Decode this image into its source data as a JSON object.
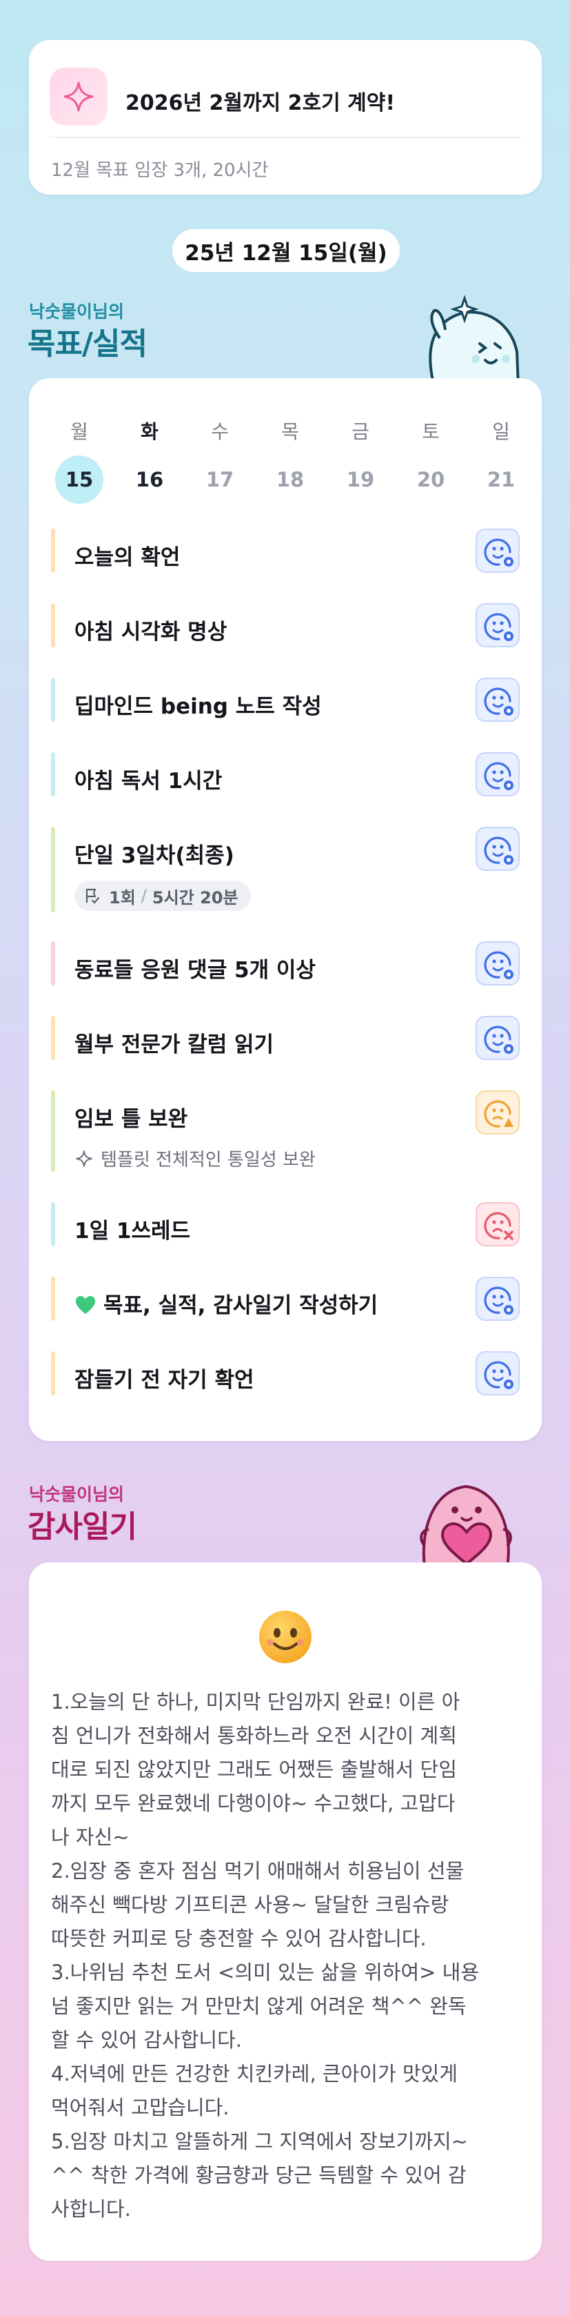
{
  "contract": {
    "title": "2026년 2월까지 2호기 계약!",
    "subtitle": "12월 목표  임장 3개, 20시간"
  },
  "date_label": "25년 12월 15일(월)",
  "goals_section": {
    "owner": "낙숫물이님의",
    "title": "목표/실적"
  },
  "week": {
    "days": [
      "월",
      "화",
      "수",
      "목",
      "금",
      "토",
      "일"
    ],
    "dates": [
      "15",
      "16",
      "17",
      "18",
      "19",
      "20",
      "21"
    ]
  },
  "goals": [
    {
      "title": "오늘의 확언",
      "bar_color": "#fde0b4",
      "status": "done"
    },
    {
      "title": "아침 시각화 명상",
      "bar_color": "#fde0b4",
      "status": "done"
    },
    {
      "title": "딥마인드 being 노트 작성",
      "bar_color": "#c8ecf4",
      "status": "done"
    },
    {
      "title": "아침 독서 1시간",
      "bar_color": "#c8ecf4",
      "status": "done"
    },
    {
      "title": "단일 3일차(최종)",
      "bar_color": "#d6eeb6",
      "status": "done",
      "chip": {
        "count": "1회",
        "sep": "/",
        "duration": "5시간 20분"
      }
    },
    {
      "title": "동료들 응원 댓글 5개 이상",
      "bar_color": "#f9d2d8",
      "status": "done"
    },
    {
      "title": "월부 전문가 칼럼 읽기",
      "bar_color": "#fde0b4",
      "status": "done"
    },
    {
      "title": "임보 틀 보완",
      "bar_color": "#d6eeb6",
      "status": "partial",
      "note": "템플릿 전체적인 통일성 보완"
    },
    {
      "title": "1일 1쓰레드",
      "bar_color": "#c8ecf4",
      "status": "failed"
    },
    {
      "title": "목표, 실적, 감사일기 작성하기",
      "bar_color": "#fde0b4",
      "status": "done",
      "emoji": "💚"
    },
    {
      "title": "잠들기 전 자기 확언",
      "bar_color": "#fde0b4",
      "status": "done"
    }
  ],
  "gratitude_section": {
    "owner": "낙숫물이님의",
    "title": "감사일기"
  },
  "gratitude": {
    "text": "1.오늘의 단 하나, 미지막 단임까지 완료! 이른 아\n침 언니가 전화해서 통화하느라 오전 시간이 계획\n대로 되진 않았지만 그래도 어쨌든 출발해서 단임\n까지 모두 완료했네 다행이야~ 수고했다, 고맙다\n나 자신~\n2.임장 중 혼자 점심 먹기 애매해서 히용님이 선물\n해주신 빽다방 기프티콘 사용~ 달달한 크림슈랑\n따뜻한 커피로 당 충전할 수 있어 감사합니다.\n3.나위님 추천 도서 <의미 있는 삶을 위하여> 내용\n넘 좋지만 읽는 거 만만치 않게 어려운 책^^ 완독\n할 수 있어 감사합니다.\n4.저녁에 만든 건강한 치킨카레, 큰아이가 맛있게\n먹어줘서 고맙습니다.\n5.임장 마치고 알뜰하게 그 지역에서 장보기까지~\n^^ 착한 가격에 황금향과 당근 득템할 수 있어 감\n사합니다."
  },
  "colors": {
    "accent_blue": "#3f6fe8",
    "warn_orange": "#f0a030",
    "fail_red": "#e55a6a"
  }
}
